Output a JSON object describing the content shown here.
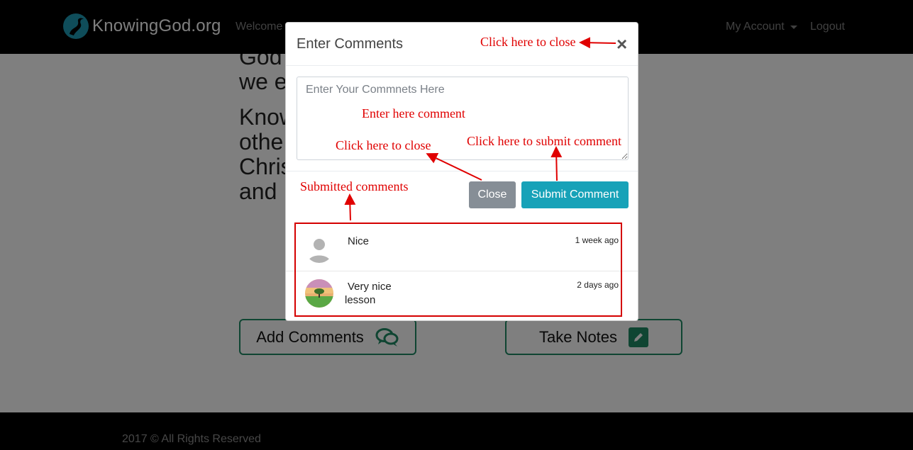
{
  "navbar": {
    "logo_text": "KnowingGod.org",
    "welcome": "Welcome",
    "account": "My Account",
    "logout": "Logout"
  },
  "page": {
    "para1": "God ... that we e...",
    "para2": "Know... othe... Chris... and ...",
    "add_comments": "Add Comments",
    "take_notes": "Take Notes"
  },
  "modal": {
    "title": "Enter Comments",
    "close_x": "×",
    "placeholder": "Enter Your Commnets Here",
    "close_label": "Close",
    "submit_label": "Submit Comment",
    "comments": [
      {
        "text": "Nice",
        "time": "1 week ago"
      },
      {
        "text": "Very nice lesson",
        "time": "2 days ago"
      }
    ]
  },
  "annotations": {
    "close_top": "Click here to close",
    "enter_comment": "Enter here comment",
    "close_button": "Click here to close",
    "submit": "Click here to submit comment",
    "submitted": "Submitted comments",
    "color": "#e00000"
  },
  "footer": {
    "text": "2017 © All Rights Reserved"
  }
}
